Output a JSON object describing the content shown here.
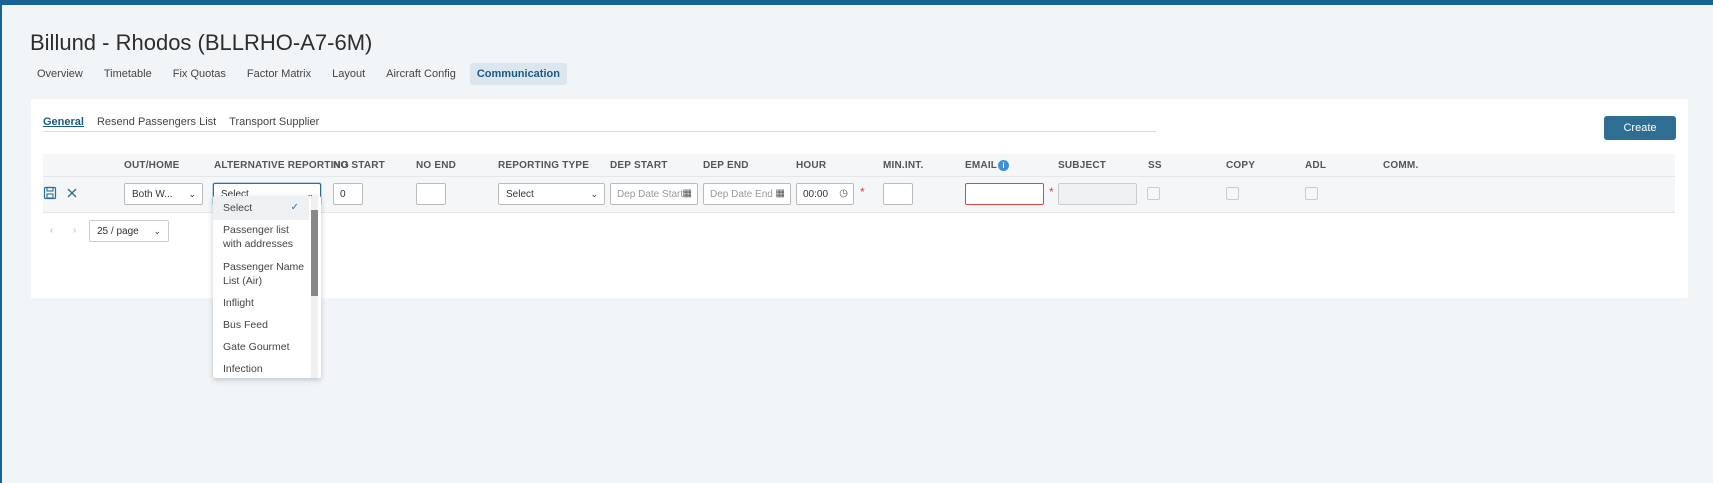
{
  "page": {
    "title": "Billund - Rhodos (BLLRHO-A7-6M)"
  },
  "main_tabs": [
    {
      "label": "Overview"
    },
    {
      "label": "Timetable"
    },
    {
      "label": "Fix Quotas"
    },
    {
      "label": "Factor Matrix"
    },
    {
      "label": "Layout"
    },
    {
      "label": "Aircraft Config"
    },
    {
      "label": "Communication"
    }
  ],
  "sub_tabs": [
    {
      "label": "General"
    },
    {
      "label": "Resend Passengers List"
    },
    {
      "label": "Transport Supplier"
    }
  ],
  "create_label": "Create",
  "columns": {
    "out_home": "OUT/HOME",
    "alt_reporting": "ALTERNATIVE REPORTING",
    "no_start": "NO START",
    "no_end": "NO END",
    "reporting_type": "REPORTING TYPE",
    "dep_start": "DEP START",
    "dep_end": "DEP END",
    "hour": "HOUR",
    "min_int": "MIN.INT.",
    "email": "EMAIL",
    "subject": "SUBJECT",
    "ss": "SS",
    "copy": "COPY",
    "adl": "ADL",
    "comm": "COMM."
  },
  "row": {
    "out_home_value": "Both W...",
    "alt_reporting_value": "Select",
    "no_start_value": "0",
    "reporting_type_value": "Select",
    "dep_start_placeholder": "Dep Date Start",
    "dep_end_placeholder": "Dep Date End",
    "hour_value": "00:00",
    "required_mark": "*"
  },
  "pagination": {
    "page_size": "25 / page",
    "prev": "‹",
    "next": "›"
  },
  "dropdown_options": [
    {
      "label": "Select"
    },
    {
      "label": "Passenger list with addresses"
    },
    {
      "label": "Passenger Name List (Air)"
    },
    {
      "label": "Inflight"
    },
    {
      "label": "Bus Feed"
    },
    {
      "label": "Gate Gourmet"
    },
    {
      "label": "Infection"
    }
  ],
  "icons": {
    "save": "save-icon",
    "cancel": "close-icon",
    "calendar": "calendar-icon",
    "clock": "clock-icon",
    "info": "info-icon"
  },
  "colors": {
    "primary": "#2e6e93",
    "error": "#e04444",
    "topbar": "#1a6396"
  }
}
